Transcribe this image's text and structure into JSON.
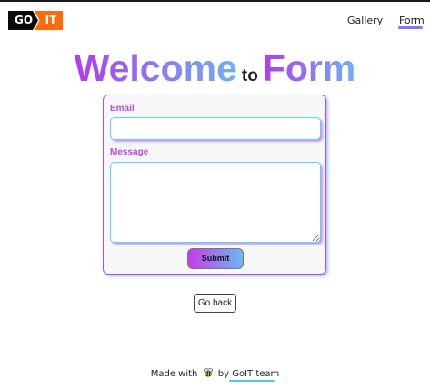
{
  "logo": {
    "part1": "GO",
    "part2": "IT"
  },
  "nav": {
    "gallery": "Gallery",
    "form": "Form"
  },
  "heading": {
    "word1": "Welcome",
    "word2": "to",
    "word3": "Form"
  },
  "form": {
    "email_label": "Email",
    "email_value": "",
    "message_label": "Message",
    "message_value": "",
    "submit_label": "Submit"
  },
  "back_button": "Go back",
  "footer": {
    "made_with": "Made with",
    "by": "by",
    "team": "GoIT team"
  },
  "colors": {
    "accent_purple": "#b44ee8",
    "accent_blue": "#6fb0f5",
    "input_border": "#57d6ee",
    "logo_orange": "#ff6b08",
    "nav_underline": "#7b7cf0"
  },
  "icons": {
    "footer_icon": "bee-icon"
  }
}
